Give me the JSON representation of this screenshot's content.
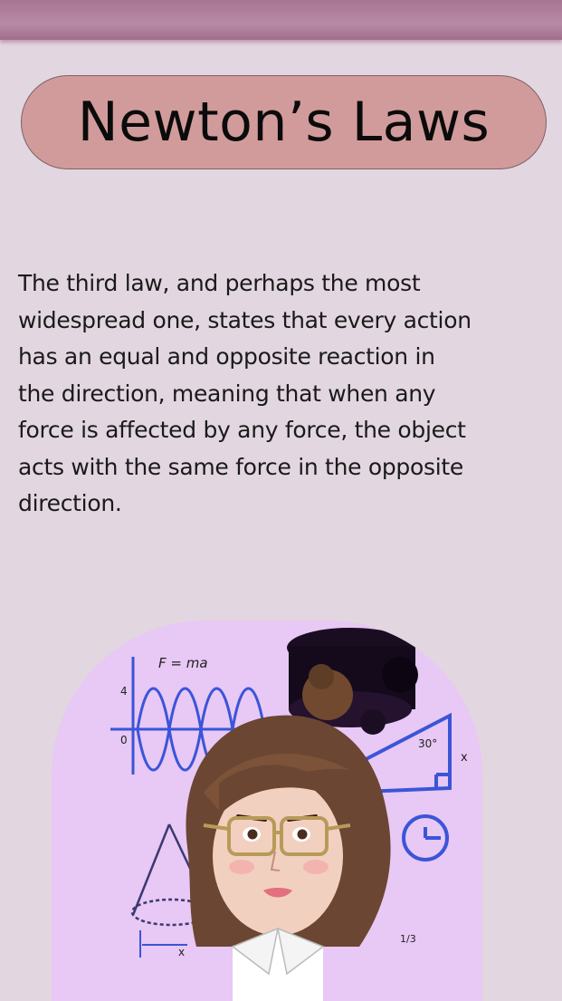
{
  "header": {
    "title": "Newton’s Laws"
  },
  "content": {
    "paragraph_lines": [
      "The third law, and perhaps the most",
      "widespread one, states that every action",
      "has an equal and opposite reaction in",
      "the direction, meaning that when any",
      "force is affected by any force, the object",
      "acts with the same force in the opposite",
      "direction."
    ]
  },
  "illustration": {
    "formula_label": "F = ma",
    "axis_tick_4": "4",
    "axis_tick_0": "0",
    "angle_label": "30°",
    "axis_x_label": "x",
    "bottom_label": "x",
    "fraction_label": "1/3"
  },
  "colors": {
    "background": "#e2d6e0",
    "top_bar": "#a57592",
    "title_pill": "#d29b9b",
    "avatar_background": "#e8c8f4",
    "diagram_blue": "#3a55d8"
  }
}
